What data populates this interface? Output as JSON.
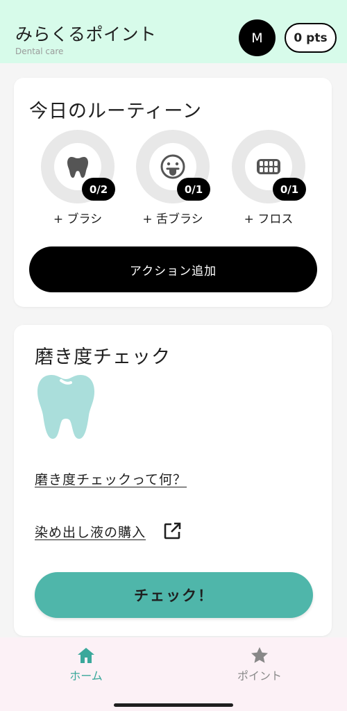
{
  "header": {
    "title": "みらくるポイント",
    "subtitle": "Dental care",
    "avatar_initial": "M",
    "points": "0 pts"
  },
  "routine": {
    "title": "今日のルーティーン",
    "items": [
      {
        "icon": "tooth-icon",
        "count": "0/2",
        "label": "+ ブラシ"
      },
      {
        "icon": "tongue-face-icon",
        "count": "0/1",
        "label": "+ 舌ブラシ"
      },
      {
        "icon": "teeth-grid-icon",
        "count": "0/1",
        "label": "+ フロス"
      }
    ],
    "add_action_label": "アクション追加"
  },
  "check": {
    "title": "磨き度チェック",
    "illustration": "tooth-illustration",
    "what_link": "磨き度チェックって何？",
    "buy_link": "染め出し液の購入",
    "button_label": "チェック！"
  },
  "nav": {
    "home_label": "ホーム",
    "points_label": "ポイント"
  },
  "colors": {
    "header_bg": "#d7fbea",
    "accent": "#4fb6aa",
    "tooth_light": "#aadedb",
    "nav_bg": "#fcf1f6",
    "nav_active": "#3aa89b"
  }
}
